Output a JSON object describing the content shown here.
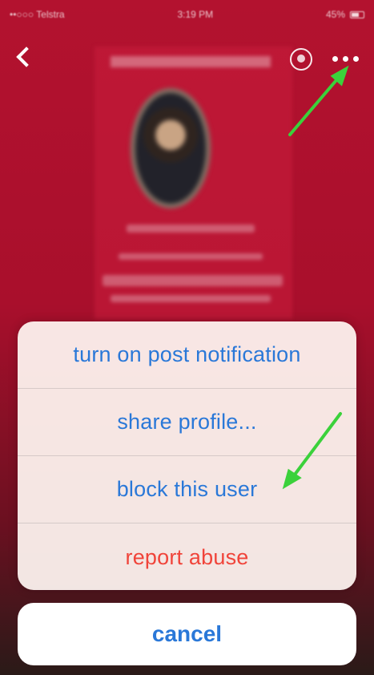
{
  "status_bar": {
    "carrier": "••○○○ Telstra",
    "time": "3:19 PM",
    "battery": "45%"
  },
  "action_sheet": {
    "items": [
      {
        "label": "turn on post notification",
        "style": "normal"
      },
      {
        "label": "share profile...",
        "style": "normal"
      },
      {
        "label": "block this user",
        "style": "normal"
      },
      {
        "label": "report abuse",
        "style": "destructive"
      }
    ],
    "cancel_label": "cancel"
  },
  "colors": {
    "background_red": "#b3122f",
    "action_blue": "#2a78d8",
    "destructive_red": "#f0443a",
    "annotation_arrow": "#3bd13b"
  },
  "icons": [
    "back-icon",
    "notify-circle-icon",
    "more-icon"
  ]
}
